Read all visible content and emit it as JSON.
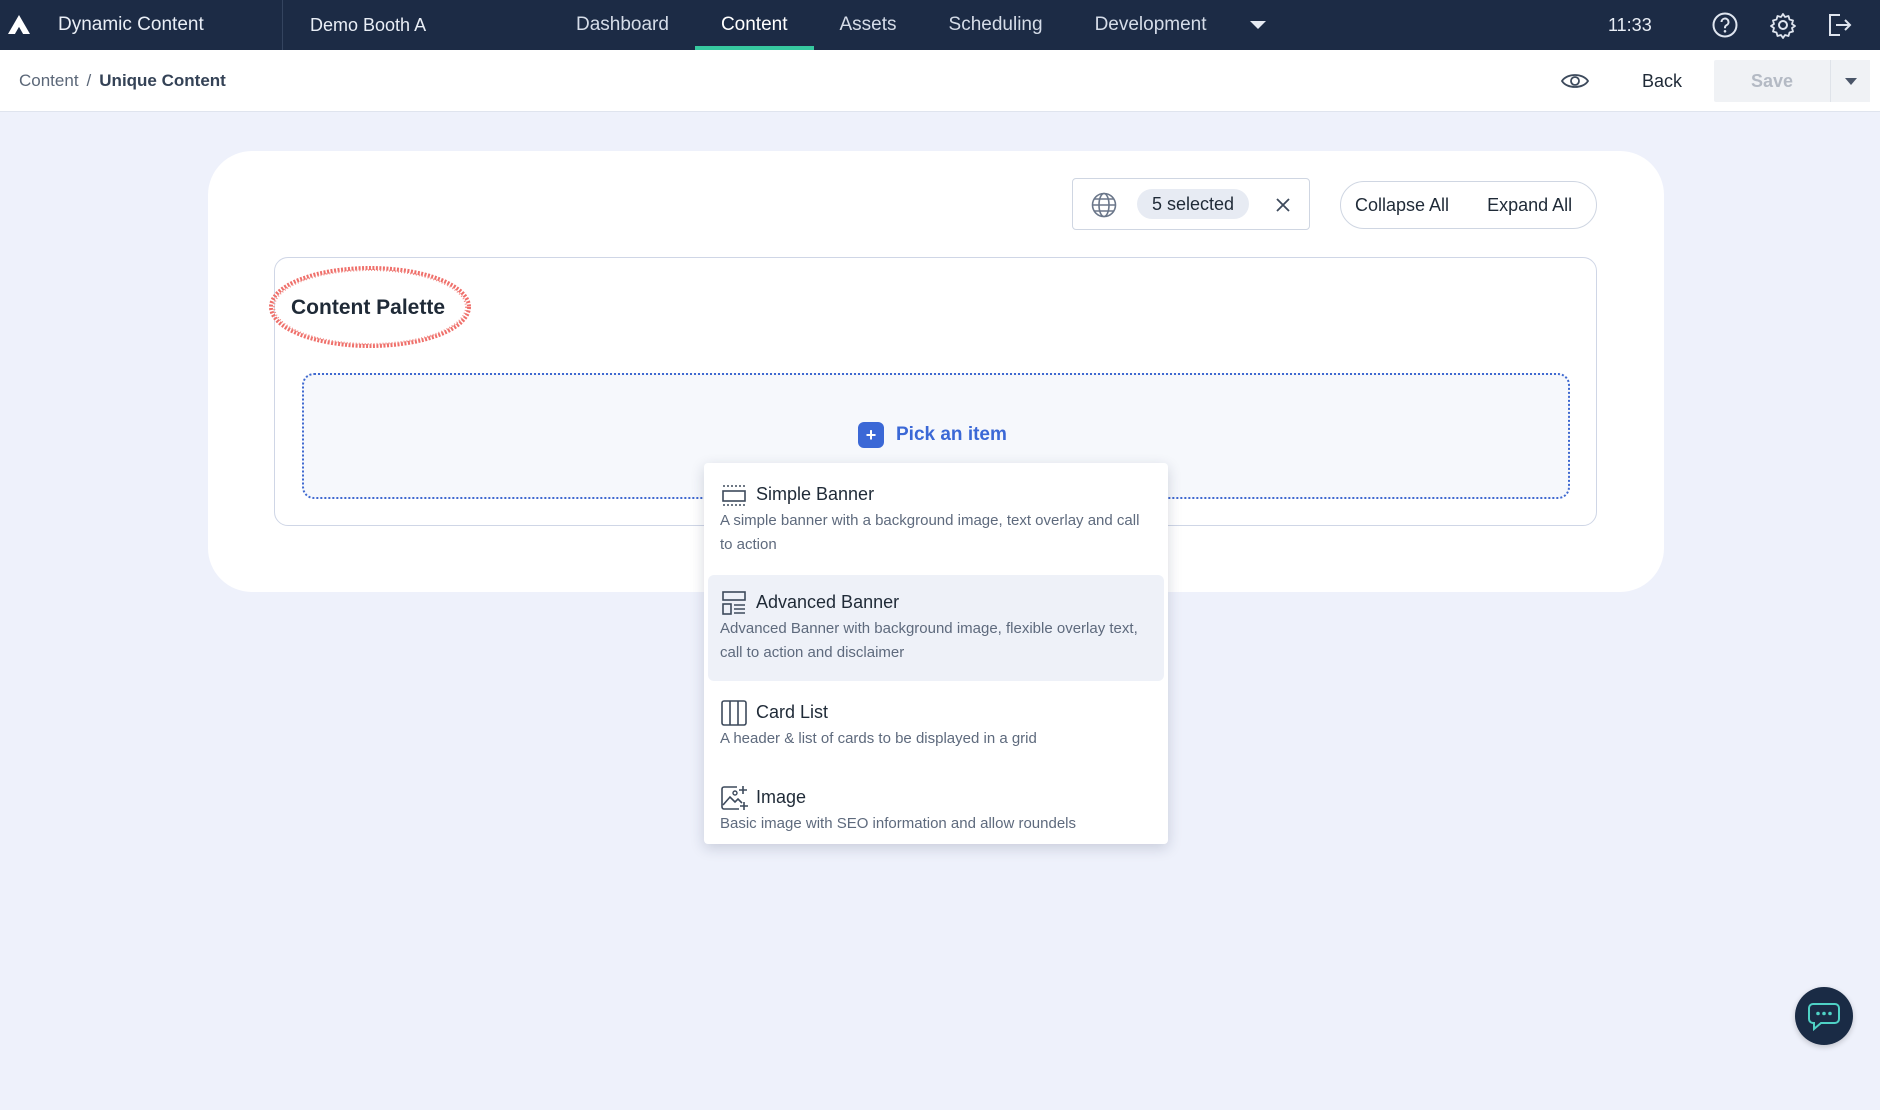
{
  "topbar": {
    "app_title": "Dynamic Content",
    "hub_name": "Demo Booth A",
    "nav": [
      "Dashboard",
      "Content",
      "Assets",
      "Scheduling",
      "Development"
    ],
    "active_nav": "Content",
    "time": "11:33",
    "icons": [
      "help-icon",
      "gear-icon",
      "logout-icon"
    ]
  },
  "subbar": {
    "breadcrumb": {
      "root": "Content",
      "separator": "/",
      "current": "Unique Content"
    },
    "back_label": "Back",
    "save_label": "Save"
  },
  "toolbar": {
    "locale_selected": "5 selected",
    "collapse_all": "Collapse All",
    "expand_all": "Expand All"
  },
  "palette": {
    "title": "Content Palette",
    "pick_label": "Pick an item"
  },
  "menu": {
    "items": [
      {
        "title": "Simple Banner",
        "desc": "A simple banner with a background image, text overlay and call to action",
        "icon": "simple-banner-icon"
      },
      {
        "title": "Advanced Banner",
        "desc": "Advanced Banner with background image, flexible overlay text, call to action and disclaimer",
        "icon": "advanced-banner-icon"
      },
      {
        "title": "Card List",
        "desc": "A header & list of cards to be displayed in a grid",
        "icon": "card-list-icon"
      },
      {
        "title": "Image",
        "desc": "Basic image with SEO information and allow roundels",
        "icon": "image-icon"
      }
    ],
    "hovered_index": 1
  },
  "colors": {
    "topbar": "#1c2b45",
    "active_tab_underline": "#37c9a0",
    "accent": "#3b68d6",
    "annotation_ring": "#ef6f6a"
  }
}
